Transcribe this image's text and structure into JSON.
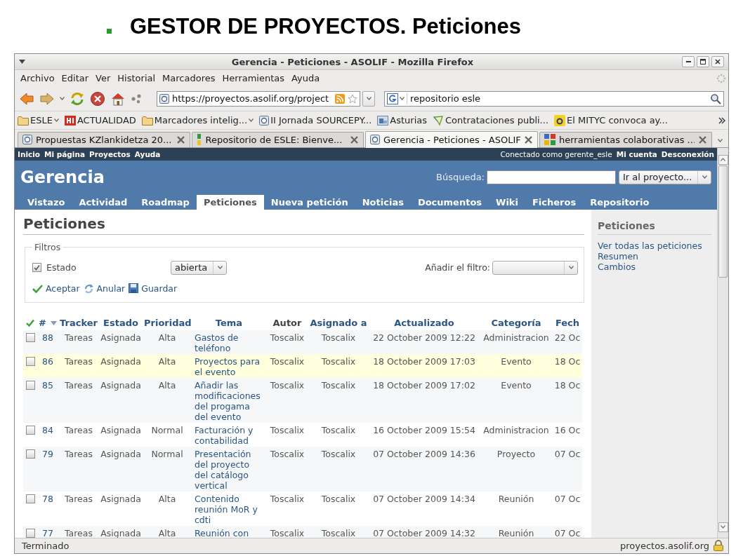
{
  "slide": {
    "title": "GESTOR DE PROYECTOS. Peticiones"
  },
  "window": {
    "title": "Gerencia - Peticiones - ASOLIF - Mozilla Firefox"
  },
  "menu": [
    "Archivo",
    "Editar",
    "Ver",
    "Historial",
    "Marcadores",
    "Herramientas",
    "Ayuda"
  ],
  "toolbar": {
    "url": "https://proyectos.asolif.org/project",
    "search": "repositorio esle"
  },
  "bookmarks": [
    {
      "label": "ESLE",
      "kind": "folder",
      "has_menu": true
    },
    {
      "label": "ACTUALIDAD",
      "kind": "red",
      "has_menu": false
    },
    {
      "label": "Marcadores intelig...",
      "kind": "folder",
      "has_menu": true
    },
    {
      "label": "II Jornada SOURCEPY...",
      "kind": "page",
      "has_menu": false
    },
    {
      "label": "Asturias",
      "kind": "image",
      "has_menu": false
    },
    {
      "label": "Contrataciones publi...",
      "kind": "leaf",
      "has_menu": false
    },
    {
      "label": "El MITYC convoca ay...",
      "kind": "yellow",
      "has_menu": false
    }
  ],
  "tabs": [
    {
      "label": "Propuestas KZlankidetza 20...",
      "kind": "page",
      "selected": false
    },
    {
      "label": "Repositorio de ESLE: Bienve...",
      "kind": "bar",
      "selected": false
    },
    {
      "label": "Gerencia - Peticiones - ASOLIF",
      "kind": "page",
      "selected": true
    },
    {
      "label": "herramientas colaborativas ...",
      "kind": "multi",
      "selected": false
    }
  ],
  "page": {
    "top_menu": [
      "Inicio",
      "Mi página",
      "Proyectos",
      "Ayuda"
    ],
    "logged_as": "Conectado como gerente_esle",
    "account_links": [
      "Mi cuenta",
      "Desconexión"
    ],
    "project_title": "Gerencia",
    "search_label": "Búsqueda:",
    "project_jump": "Ir al proyecto...",
    "main_menu": [
      {
        "label": "Vistazo",
        "selected": false
      },
      {
        "label": "Actividad",
        "selected": false
      },
      {
        "label": "Roadmap",
        "selected": false
      },
      {
        "label": "Peticiones",
        "selected": true
      },
      {
        "label": "Nueva petición",
        "selected": false
      },
      {
        "label": "Noticias",
        "selected": false
      },
      {
        "label": "Documentos",
        "selected": false
      },
      {
        "label": "Wiki",
        "selected": false
      },
      {
        "label": "Ficheros",
        "selected": false
      },
      {
        "label": "Repositorio",
        "selected": false
      }
    ],
    "heading": "Peticiones",
    "filters": {
      "legend": "Filtros",
      "field": {
        "label": "Estado",
        "checked": true
      },
      "operator": "abierta",
      "add_label": "Añadir el filtro:"
    },
    "actions": [
      {
        "label": "Aceptar",
        "kind": "apply"
      },
      {
        "label": "Anular",
        "kind": "clear"
      },
      {
        "label": "Guardar",
        "kind": "save"
      }
    ],
    "table": {
      "columns": [
        {
          "label": "#",
          "link": true,
          "sorted": true
        },
        {
          "label": "Tracker",
          "link": true,
          "sorted": false
        },
        {
          "label": "Estado",
          "link": true,
          "sorted": false
        },
        {
          "label": "Prioridad",
          "link": true,
          "sorted": false
        },
        {
          "label": "Tema",
          "link": true,
          "sorted": false
        },
        {
          "label": "Autor",
          "link": false,
          "sorted": false
        },
        {
          "label": "Asignado a",
          "link": true,
          "sorted": false
        },
        {
          "label": "Actualizado",
          "link": true,
          "sorted": false
        },
        {
          "label": "Categoría",
          "link": true,
          "sorted": false
        },
        {
          "label": "Fech",
          "link": true,
          "sorted": false
        }
      ],
      "rows": [
        {
          "checked": false,
          "highlighted": false,
          "cells": [
            "88",
            "Tareas",
            "Asignada",
            "Alta",
            "Gastos de teléfono",
            "Toscalix",
            "Toscalix",
            "22 October 2009 12:22",
            "Administracion",
            "22 Oc"
          ]
        },
        {
          "checked": false,
          "highlighted": true,
          "cells": [
            "86",
            "Tareas",
            "Asignada",
            "Alta",
            "Proyectos para el evento",
            "Toscalix",
            "Toscalix",
            "18 October 2009 17:03",
            "Evento",
            "18 Oc"
          ]
        },
        {
          "checked": false,
          "highlighted": false,
          "cells": [
            "85",
            "Tareas",
            "Asignada",
            "Alta",
            "Añadir las modificaciones del progama del evento",
            "Toscalix",
            "Toscalix",
            "18 October 2009 17:02",
            "Evento",
            "18 Oc"
          ]
        },
        {
          "checked": false,
          "highlighted": false,
          "cells": [
            "84",
            "Tareas",
            "Asignada",
            "Normal",
            "Facturación y contabilidad",
            "Toscalix",
            "Toscalix",
            "16 October 2009 15:54",
            "Administracion",
            "16 Oc"
          ]
        },
        {
          "checked": false,
          "highlighted": false,
          "cells": [
            "79",
            "Tareas",
            "Asignada",
            "Normal",
            "Presentación del proyecto del catálogo vertical",
            "Toscalix",
            "Toscalix",
            "07 October 2009 14:36",
            "Proyecto",
            "07 Oc"
          ]
        },
        {
          "checked": false,
          "highlighted": false,
          "cells": [
            "78",
            "Tareas",
            "Asignada",
            "Alta",
            "Contenido reunión MoR y cdti",
            "Toscalix",
            "Toscalix",
            "07 October 2009 14:34",
            "Reunión",
            "07 Oc"
          ]
        },
        {
          "checked": false,
          "highlighted": false,
          "cells": [
            "77",
            "Tareas",
            "Asignada",
            "Alta",
            "Reunión con",
            "Toscalix",
            "Toscalix",
            "07 October 2009 14:32",
            "Reunión",
            "07 Oc"
          ]
        }
      ]
    },
    "sidebar": {
      "title": "Peticiones",
      "links": [
        "Ver todas las peticiones",
        "Resumen",
        "Cambios"
      ]
    }
  },
  "status_bar": {
    "text": "Terminado",
    "host": "proyectos.asolif.org"
  }
}
